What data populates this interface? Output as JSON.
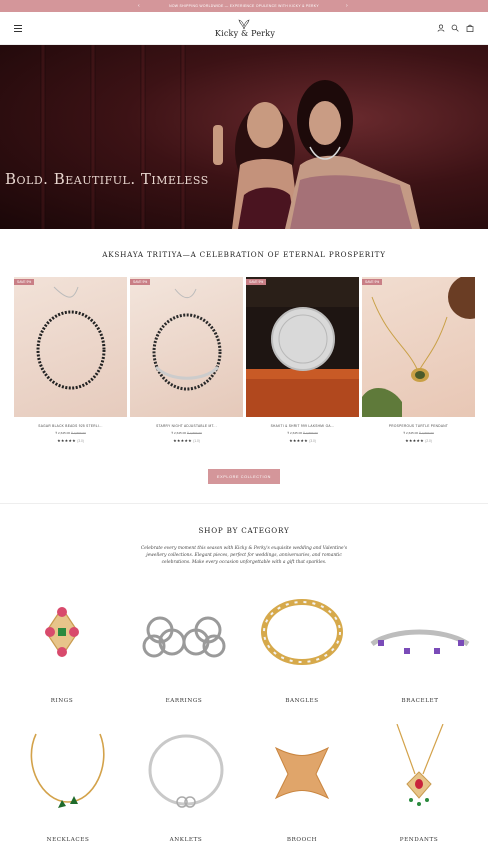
{
  "announcement": {
    "text": "NOW SHIPPING WORLDWIDE — EXPERIENCE OPULENCE WITH KICKY & PERKY"
  },
  "header": {
    "brand": "Kicky & Perky"
  },
  "hero": {
    "headline": "Bold. Beautiful. Timeless"
  },
  "collection": {
    "title": "AKSHAYA TRITIYA—A CELEBRATION OF ETERNAL PROSPERITY",
    "products": [
      {
        "badge": "SAVE 9%",
        "name": "SAGAR BLACK BEADS 925 STERLI...",
        "price": "₹ 2,645.00",
        "compare_price": "₹ 2,899.00",
        "rating": 5,
        "stars": "★★★★★",
        "reviews": "(3.0)"
      },
      {
        "badge": "SAVE 9%",
        "name": "STARRY NIGHT ADJUSTABLE MT...",
        "price": "₹ 2,645.00",
        "compare_price": "₹ 2,899.00",
        "rating": 5,
        "stars": "★★★★★",
        "reviews": "(1.0)"
      },
      {
        "badge": "SAVE 9%",
        "name": "SHAKTI & SHRIT 999 LAKSHMI GA...",
        "price": "₹ 2,645.00",
        "compare_price": "₹ 2,899.00",
        "rating": 5,
        "stars": "★★★★★",
        "reviews": "(3.0)"
      },
      {
        "badge": "SAVE 9%",
        "name": "PROSPEROUS TURTLE PENDANT",
        "price": "₹ 2,645.00",
        "compare_price": "₹ 2,899.00",
        "rating": 5,
        "stars": "★★★★★",
        "reviews": "(2.0)"
      }
    ],
    "button_label": "EXPLORE COLLECTION"
  },
  "categories": {
    "title": "SHOP BY CATEGORY",
    "description": "Celebrate every moment this season with Kicky & Perky's exquisite wedding and Valentine's jewellery collections. Elegant pieces, perfect for weddings, anniversaries, and romantic celebrations. Make every occasion unforgettable with a gift that sparkles.",
    "items": [
      {
        "label": "RINGS"
      },
      {
        "label": "EARRINGS"
      },
      {
        "label": "BANGLES"
      },
      {
        "label": "BRACELET"
      },
      {
        "label": "NECKLACES"
      },
      {
        "label": "ANKLETS"
      },
      {
        "label": "BROOCH"
      },
      {
        "label": "PENDANTS"
      }
    ]
  },
  "colors": {
    "accent": "#d4969a",
    "badge": "#c97f86",
    "text": "#222222"
  }
}
